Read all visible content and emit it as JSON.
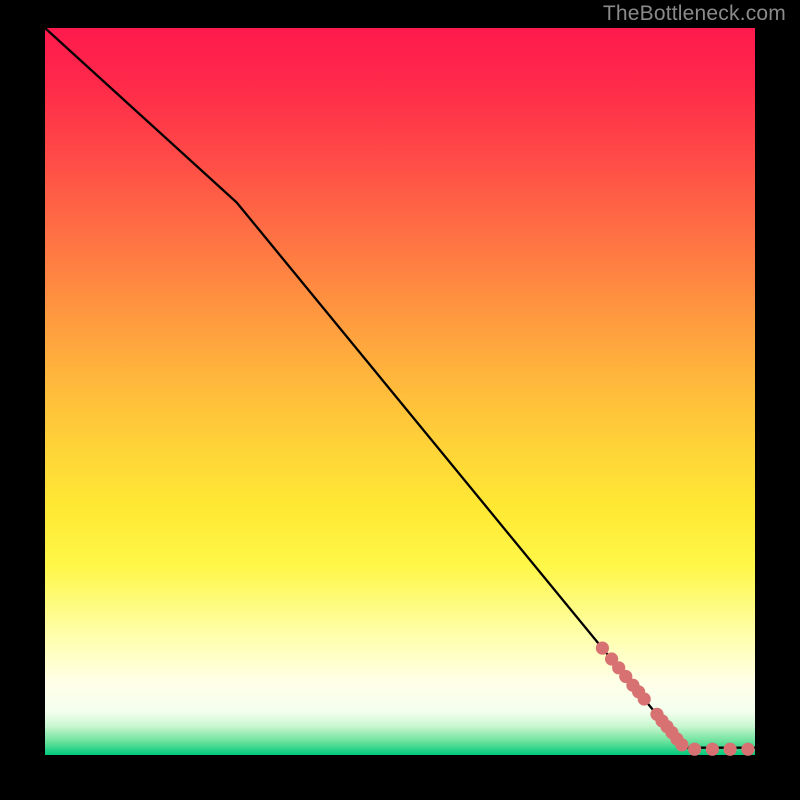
{
  "attribution": "TheBottleneck.com",
  "colors": {
    "line": "#000000",
    "marker_fill": "#d87272",
    "marker_stroke": "#d87272"
  },
  "chart_data": {
    "type": "line",
    "title": "",
    "xlabel": "",
    "ylabel": "",
    "xlim": [
      0,
      100
    ],
    "ylim": [
      0,
      100
    ],
    "grid": false,
    "legend": false,
    "series": [
      {
        "name": "curve",
        "type": "line",
        "x": [
          0,
          27,
          90,
          100
        ],
        "y": [
          100,
          76,
          1,
          1
        ]
      },
      {
        "name": "markers",
        "type": "scatter",
        "x": [
          78.5,
          79.8,
          80.8,
          81.8,
          82.8,
          83.6,
          84.4,
          86.2,
          86.9,
          87.6,
          88.3,
          89.0,
          89.7,
          91.5,
          94.0,
          96.5,
          99.0
        ],
        "y": [
          14.7,
          13.2,
          12.0,
          10.8,
          9.6,
          8.7,
          7.7,
          5.6,
          4.7,
          3.9,
          3.1,
          2.2,
          1.4,
          0.8,
          0.8,
          0.8,
          0.8
        ]
      }
    ]
  }
}
